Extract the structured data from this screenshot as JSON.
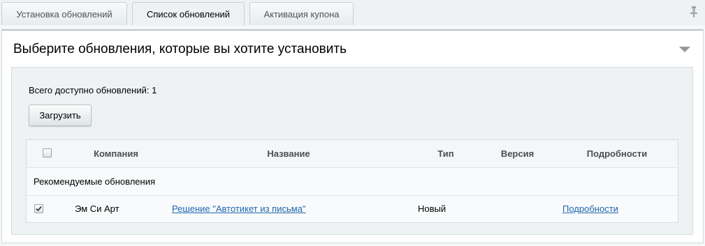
{
  "tabs": [
    {
      "label": "Установка обновлений",
      "active": false
    },
    {
      "label": "Список обновлений",
      "active": true
    },
    {
      "label": "Активация купона",
      "active": false
    }
  ],
  "icons": {
    "pin": "pin-icon",
    "collapse": "chevron-down-icon"
  },
  "panel": {
    "title": "Выберите обновления, которые вы хотите установить",
    "total_label": "Всего доступно обновлений: 1",
    "load_button": "Загрузить"
  },
  "table": {
    "headers": {
      "company": "Компания",
      "name": "Название",
      "type": "Тип",
      "version": "Версия",
      "details": "Подробности"
    },
    "header_checkbox_checked": false,
    "group_label": "Рекомендуемые обновления",
    "rows": [
      {
        "checked": true,
        "company": "Эм Си Арт",
        "name": "Решение \"Автотикет из письма\"",
        "type": "Новый",
        "version": "",
        "details": "Подробности"
      }
    ]
  },
  "colors": {
    "link": "#2066b0",
    "background": "#eef2f4"
  }
}
